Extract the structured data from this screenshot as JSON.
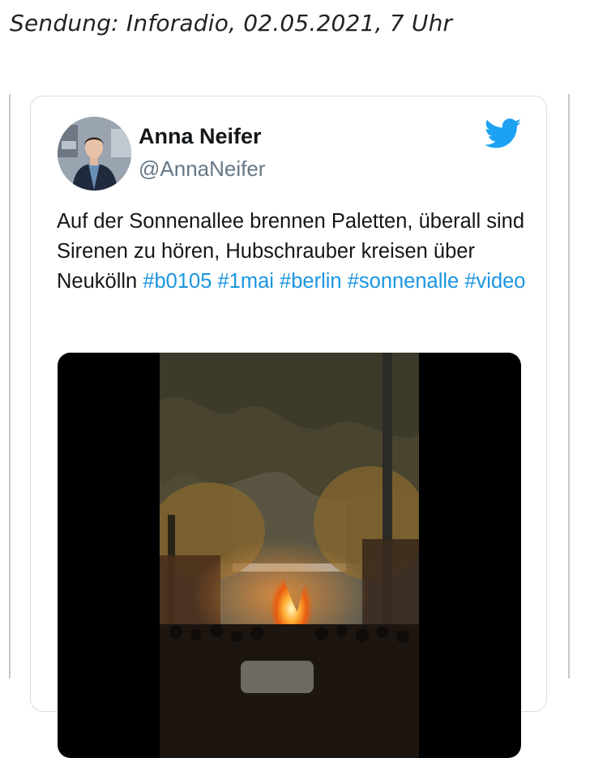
{
  "broadcast": {
    "text": "Sendung: Inforadio, 02.05.2021, 7 Uhr"
  },
  "tweet": {
    "author_name": "Anna Neifer",
    "author_handle": "@AnnaNeifer",
    "text_segments": [
      {
        "text": "Auf der Sonnenallee brennen Paletten, überall sind Sirenen zu hören, Hubschrauber kreisen über Neukölln ",
        "type": "text"
      },
      {
        "text": "#b0105",
        "type": "hashtag"
      },
      {
        "text": " ",
        "type": "text"
      },
      {
        "text": "#1mai",
        "type": "hashtag"
      },
      {
        "text": " ",
        "type": "text"
      },
      {
        "text": "#berlin",
        "type": "hashtag"
      },
      {
        "text": " ",
        "type": "text"
      },
      {
        "text": "#sonnenalle",
        "type": "hashtag"
      },
      {
        "text": " ",
        "type": "text"
      },
      {
        "text": "#video",
        "type": "hashtag"
      }
    ],
    "icon": "twitter-bird-icon"
  },
  "colors": {
    "hashtag": "#1b95e0",
    "twitter_blue": "#1da1f2",
    "handle_gray": "#657786"
  }
}
